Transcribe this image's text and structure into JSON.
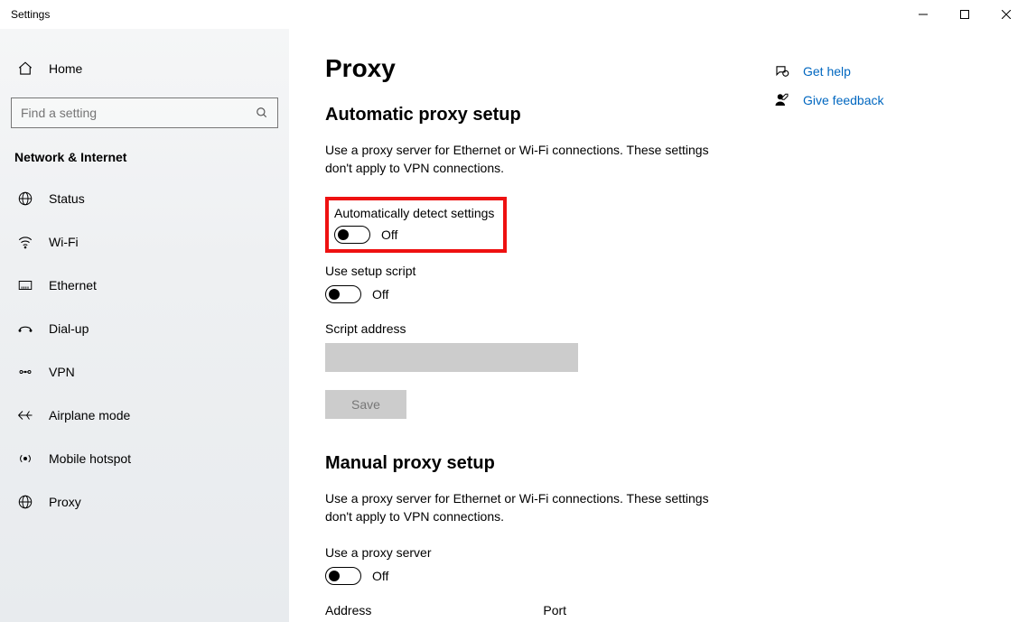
{
  "window": {
    "title": "Settings"
  },
  "sidebar": {
    "home": "Home",
    "search_placeholder": "Find a setting",
    "category": "Network & Internet",
    "items": [
      {
        "label": "Status"
      },
      {
        "label": "Wi-Fi"
      },
      {
        "label": "Ethernet"
      },
      {
        "label": "Dial-up"
      },
      {
        "label": "VPN"
      },
      {
        "label": "Airplane mode"
      },
      {
        "label": "Mobile hotspot"
      },
      {
        "label": "Proxy"
      }
    ]
  },
  "main": {
    "title": "Proxy",
    "auto": {
      "heading": "Automatic proxy setup",
      "desc": "Use a proxy server for Ethernet or Wi-Fi connections. These settings don't apply to VPN connections.",
      "detect_label": "Automatically detect settings",
      "detect_state": "Off",
      "script_label": "Use setup script",
      "script_state": "Off",
      "address_label": "Script address",
      "address_value": "",
      "save": "Save"
    },
    "manual": {
      "heading": "Manual proxy setup",
      "desc": "Use a proxy server for Ethernet or Wi-Fi connections. These settings don't apply to VPN connections.",
      "use_label": "Use a proxy server",
      "use_state": "Off",
      "address_label": "Address",
      "port_label": "Port"
    }
  },
  "help": {
    "get_help": "Get help",
    "feedback": "Give feedback"
  }
}
